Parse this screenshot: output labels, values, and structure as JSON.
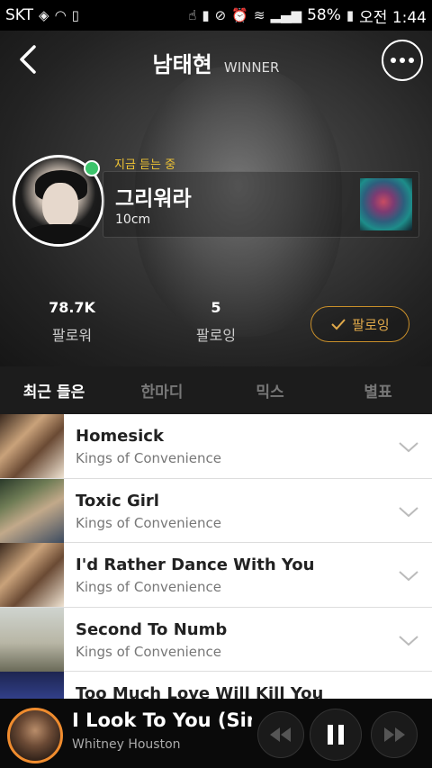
{
  "statusbar": {
    "carrier": "SKT",
    "battery": "58%",
    "time": "오전 1:44"
  },
  "header": {
    "artist_name": "남태현",
    "group_name": "WINNER"
  },
  "now_playing_card": {
    "label": "지금 듣는 중",
    "song": "그리워라",
    "artist": "10cm"
  },
  "stats": {
    "followers_count": "78.7K",
    "followers_label": "팔로워",
    "following_count": "5",
    "following_label": "팔로잉"
  },
  "follow_button": {
    "label": "팔로잉"
  },
  "tabs": [
    {
      "label": "최근 들은",
      "active": true
    },
    {
      "label": "한마디",
      "active": false
    },
    {
      "label": "믹스",
      "active": false
    },
    {
      "label": "별표",
      "active": false
    }
  ],
  "tracks": [
    {
      "title": "Homesick",
      "artist": "Kings of Convenience"
    },
    {
      "title": "Toxic Girl",
      "artist": "Kings of Convenience"
    },
    {
      "title": "I'd Rather Dance With You",
      "artist": "Kings of Convenience"
    },
    {
      "title": "Second To Numb",
      "artist": "Kings of Convenience"
    },
    {
      "title": "Too Much Love Will Kill You",
      "artist": ""
    }
  ],
  "player": {
    "song": "I Look To You (Sin…",
    "artist": "Whitney Houston"
  },
  "colors": {
    "accent_orange": "#f08c2e",
    "follow_gold": "#c98f2a",
    "online_green": "#3cc46b",
    "now_label_yellow": "#f0c434"
  },
  "icons": {
    "back": "chevron-left-icon",
    "more": "more-dots-icon",
    "row_expand": "chevron-down-icon",
    "prev": "rewind-icon",
    "pause": "pause-icon",
    "next": "fast-forward-icon"
  }
}
